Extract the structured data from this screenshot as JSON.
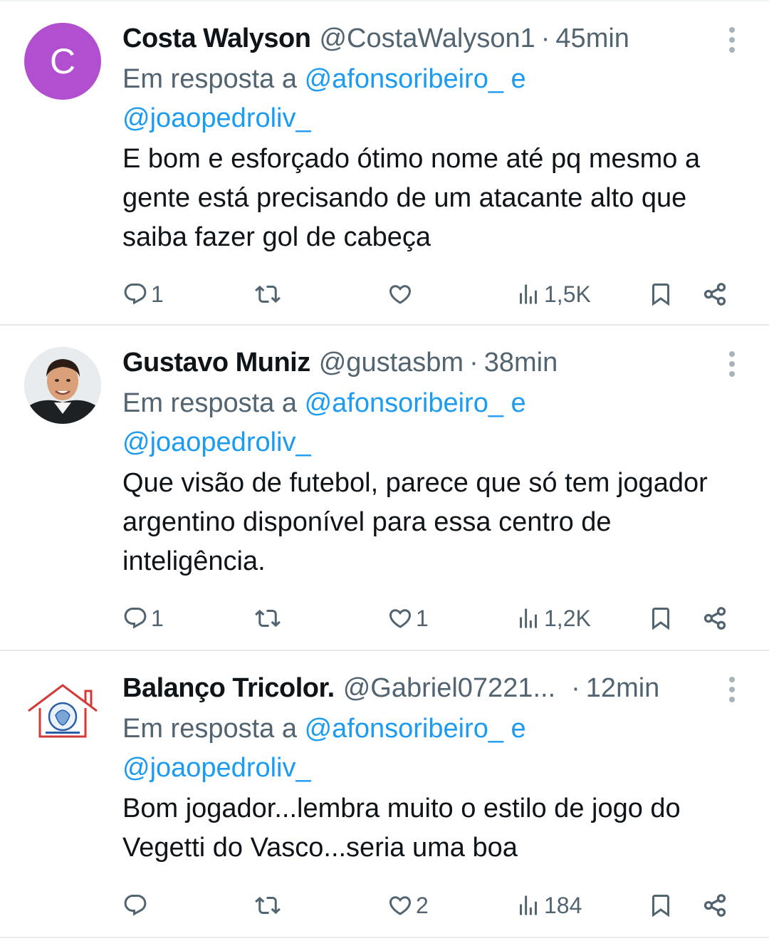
{
  "tweets": [
    {
      "name": "Costa Walyson",
      "handle": "@CostaWalyson1",
      "separator": "·",
      "time": "45min",
      "avatar_letter": "C",
      "avatar_color": "#b14fd0",
      "reply_prefix": "Em resposta a",
      "reply_mention1": "@afonsoribeiro_",
      "reply_and": "e",
      "reply_mention2": "@joaopedroliv_",
      "text": "E bom e esforçado ótimo nome até pq mesmo a gente está precisando de um atacante alto que saiba fazer gol de cabeça",
      "replies": "1",
      "retweets": "",
      "likes": "",
      "views": "1,5K"
    },
    {
      "name": "Gustavo Muniz",
      "handle": "@gustasbm",
      "separator": "·",
      "time": "38min",
      "reply_prefix": "Em resposta a",
      "reply_mention1": "@afonsoribeiro_",
      "reply_and": "e",
      "reply_mention2": "@joaopedroliv_",
      "text": "Que visão de futebol, parece que só tem jogador argentino disponível para essa centro de inteligência.",
      "replies": "1",
      "retweets": "",
      "likes": "1",
      "views": "1,2K"
    },
    {
      "name": "Balanço Tricolor.",
      "handle": "@Gabriel07221...",
      "separator": "·",
      "time": "12min",
      "reply_prefix": "Em resposta a",
      "reply_mention1": "@afonsoribeiro_",
      "reply_and": "e",
      "reply_mention2": "@joaopedroliv_",
      "text": "Bom jogador...lembra muito o estilo de jogo do Vegetti do Vasco...seria uma boa",
      "replies": "",
      "retweets": "",
      "likes": "2",
      "views": "184"
    }
  ],
  "colors": {
    "accent": "#1d9bf0",
    "secondary_text": "#536471",
    "primary_text": "#0f1419"
  }
}
